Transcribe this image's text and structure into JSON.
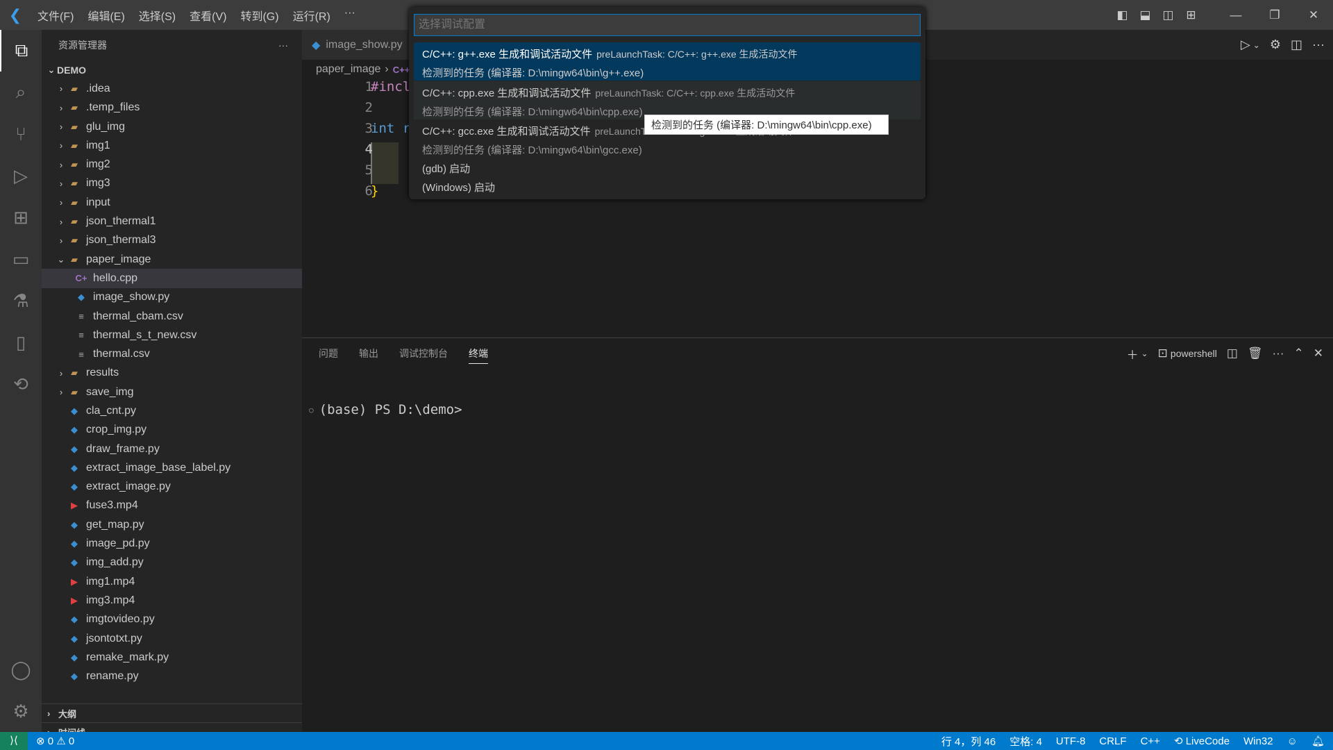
{
  "menu": [
    "文件(F)",
    "编辑(E)",
    "选择(S)",
    "查看(V)",
    "转到(G)",
    "运行(R)",
    "···"
  ],
  "sidebar": {
    "title": "资源管理器",
    "more": "···",
    "root": "DEMO",
    "items": [
      {
        "name": ".idea",
        "type": "folder",
        "depth": 1,
        "expanded": false
      },
      {
        "name": ".temp_files",
        "type": "folder",
        "depth": 1,
        "expanded": false
      },
      {
        "name": "glu_img",
        "type": "folder",
        "depth": 1,
        "expanded": false
      },
      {
        "name": "img1",
        "type": "folder",
        "depth": 1,
        "expanded": false
      },
      {
        "name": "img2",
        "type": "folder",
        "depth": 1,
        "expanded": false
      },
      {
        "name": "img3",
        "type": "folder",
        "depth": 1,
        "expanded": false
      },
      {
        "name": "input",
        "type": "folder",
        "depth": 1,
        "expanded": false
      },
      {
        "name": "json_thermal1",
        "type": "folder",
        "depth": 1,
        "expanded": false
      },
      {
        "name": "json_thermal3",
        "type": "folder",
        "depth": 1,
        "expanded": false
      },
      {
        "name": "paper_image",
        "type": "folder",
        "depth": 1,
        "expanded": true
      },
      {
        "name": "hello.cpp",
        "type": "cpp",
        "depth": 2,
        "selected": true
      },
      {
        "name": "image_show.py",
        "type": "py",
        "depth": 2
      },
      {
        "name": "thermal_cbam.csv",
        "type": "txt",
        "depth": 2
      },
      {
        "name": "thermal_s_t_new.csv",
        "type": "txt",
        "depth": 2
      },
      {
        "name": "thermal.csv",
        "type": "txt",
        "depth": 2
      },
      {
        "name": "results",
        "type": "folder",
        "depth": 1,
        "expanded": false
      },
      {
        "name": "save_img",
        "type": "folder",
        "depth": 1,
        "expanded": false
      },
      {
        "name": "cla_cnt.py",
        "type": "py",
        "depth": 1
      },
      {
        "name": "crop_img.py",
        "type": "py",
        "depth": 1
      },
      {
        "name": "draw_frame.py",
        "type": "py",
        "depth": 1
      },
      {
        "name": "extract_image_base_label.py",
        "type": "py",
        "depth": 1
      },
      {
        "name": "extract_image.py",
        "type": "py",
        "depth": 1
      },
      {
        "name": "fuse3.mp4",
        "type": "mp4",
        "depth": 1
      },
      {
        "name": "get_map.py",
        "type": "py",
        "depth": 1
      },
      {
        "name": "image_pd.py",
        "type": "py",
        "depth": 1
      },
      {
        "name": "img_add.py",
        "type": "py",
        "depth": 1
      },
      {
        "name": "img1.mp4",
        "type": "mp4",
        "depth": 1
      },
      {
        "name": "img3.mp4",
        "type": "mp4",
        "depth": 1
      },
      {
        "name": "imgtovideo.py",
        "type": "py",
        "depth": 1
      },
      {
        "name": "jsontotxt.py",
        "type": "py",
        "depth": 1
      },
      {
        "name": "remake_mark.py",
        "type": "py",
        "depth": 1
      },
      {
        "name": "rename.py",
        "type": "py",
        "depth": 1
      }
    ],
    "outline": "大纲",
    "timeline": "时间线"
  },
  "editor": {
    "tab": "image_show.py",
    "breadcrumb": [
      "paper_image",
      "C++"
    ],
    "lines": [
      {
        "n": "1",
        "text": "#incl",
        "color": "#c586c0"
      },
      {
        "n": "2",
        "text": "",
        "color": "#ccc"
      },
      {
        "n": "3",
        "text": "int r",
        "color": "#569cd6"
      },
      {
        "n": "4",
        "text": "",
        "color": "#ccc"
      },
      {
        "n": "5",
        "text": "",
        "color": "#ccc"
      },
      {
        "n": "6",
        "text": "}",
        "color": "#ffd700"
      }
    ],
    "current_line": "4"
  },
  "quickpick": {
    "placeholder": "选择调试配置",
    "items": [
      {
        "label": "C/C++: g++.exe 生成和调试活动文件",
        "desc": "preLaunchTask: C/C++: g++.exe 生成活动文件",
        "detail": "检测到的任务 (编译器: D:\\mingw64\\bin\\g++.exe)"
      },
      {
        "label": "C/C++: cpp.exe 生成和调试活动文件",
        "desc": "preLaunchTask: C/C++: cpp.exe 生成活动文件",
        "detail": "检测到的任务 (编译器: D:\\mingw64\\bin\\cpp.exe)"
      },
      {
        "label": "C/C++: gcc.exe 生成和调试活动文件",
        "desc": "preLaunchTask: C/C++: gcc.exe 生成活动文件",
        "detail": "检测到的任务 (编译器: D:\\mingw64\\bin\\gcc.exe)"
      },
      {
        "label": "(gdb) 启动"
      },
      {
        "label": "(Windows) 启动"
      }
    ],
    "tooltip": "检测到的任务 (编译器: D:\\mingw64\\bin\\cpp.exe)"
  },
  "panel": {
    "tabs": [
      "问题",
      "输出",
      "调试控制台",
      "终端"
    ],
    "active": "终端",
    "shell": "powershell",
    "prompt": "(base) PS D:\\demo>"
  },
  "status": {
    "errors": "0",
    "warnings": "0",
    "position": "行 4，列 46",
    "spaces": "空格: 4",
    "encoding": "UTF-8",
    "eol": "CRLF",
    "language": "C++",
    "livecode": "LiveCode",
    "platform": "Win32"
  },
  "colors": {
    "accent": "#007acc",
    "selection": "#04395e"
  }
}
